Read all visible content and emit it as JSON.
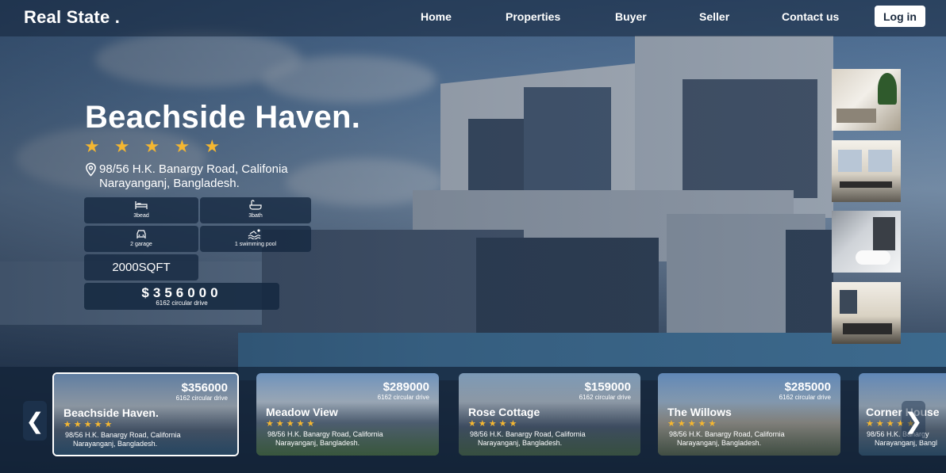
{
  "nav": {
    "logo": "Real State .",
    "links": [
      "Home",
      "Properties",
      "Buyer",
      "Seller",
      "Contact us"
    ],
    "login": "Log in"
  },
  "hero": {
    "title": "Beachside Haven.",
    "stars": "★ ★ ★ ★ ★",
    "address_line1": "98/56 H.K. Banargy Road, Califonia",
    "address_line2": "Narayanganj, Bangladesh.",
    "features": [
      {
        "icon": "bed-icon",
        "label": "3bead"
      },
      {
        "icon": "bath-icon",
        "label": "3bath"
      },
      {
        "icon": "car-icon",
        "label": "2 garage"
      },
      {
        "icon": "pool-icon",
        "label": "1 swimming pool"
      }
    ],
    "sqft": "2000SQFT",
    "price": "$356000",
    "price_sub": "6162 circular drive"
  },
  "carousel": {
    "prev": "❮",
    "next": "❯",
    "cards": [
      {
        "name": "Beachside Haven.",
        "price": "$356000",
        "sub": "6162 circular drive",
        "stars": "★★★★★",
        "addr1": "98/56 H.K. Banargy Road, California",
        "addr2": "Narayanganj, Bangladesh."
      },
      {
        "name": "Meadow View",
        "price": "$289000",
        "sub": "6162 circular drive",
        "stars": "★★★★★",
        "addr1": "98/56 H.K. Banargy Road, California",
        "addr2": "Narayanganj, Bangladesh."
      },
      {
        "name": "Rose Cottage",
        "price": "$159000",
        "sub": "6162 circular drive",
        "stars": "★★★★★",
        "addr1": "98/56 H.K. Banargy Road, California",
        "addr2": "Narayanganj, Bangladesh."
      },
      {
        "name": "The Willows",
        "price": "$285000",
        "sub": "6162 circular drive",
        "stars": "★★★★★",
        "addr1": "98/56 H.K. Banargy Road, California",
        "addr2": "Narayanganj, Bangladesh."
      },
      {
        "name": "Corner House",
        "price": "",
        "sub": "",
        "stars": "★★★★★",
        "addr1": "98/56 H.K. Banargy",
        "addr2": "Narayanganj, Bangl"
      }
    ]
  },
  "colors": {
    "accent_star": "#f5b731",
    "panel": "#14283f"
  }
}
